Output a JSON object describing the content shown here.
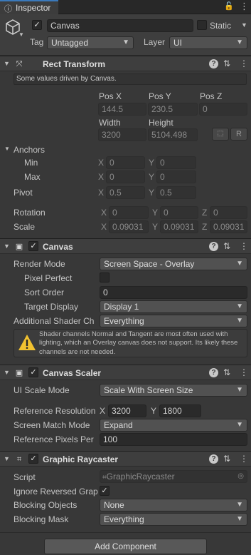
{
  "tab": {
    "title": "Inspector",
    "lock_icon": "lock-icon",
    "menu_icon": "kebab-menu-icon"
  },
  "object": {
    "name": "Canvas",
    "static_label": "Static",
    "tag_label": "Tag",
    "tag_value": "Untagged",
    "layer_label": "Layer",
    "layer_value": "UI"
  },
  "rect_transform": {
    "title": "Rect Transform",
    "info": "Some values driven by Canvas.",
    "pos_x_label": "Pos X",
    "pos_y_label": "Pos Y",
    "pos_z_label": "Pos Z",
    "pos_x": "144.5",
    "pos_y": "230.5",
    "pos_z": "0",
    "width_label": "Width",
    "height_label": "Height",
    "width": "3200",
    "height": "5104.498",
    "r_button": "R",
    "anchors_label": "Anchors",
    "min_label": "Min",
    "max_label": "Max",
    "min_x": "0",
    "min_y": "0",
    "max_x": "0",
    "max_y": "0",
    "pivot_label": "Pivot",
    "pivot_x": "0.5",
    "pivot_y": "0.5",
    "rotation_label": "Rotation",
    "rot_x": "0",
    "rot_y": "0",
    "rot_z": "0",
    "scale_label": "Scale",
    "scale_x": "0.09031",
    "scale_y": "0.09031",
    "scale_z": "0.09031"
  },
  "canvas": {
    "title": "Canvas",
    "render_mode_label": "Render Mode",
    "render_mode": "Screen Space - Overlay",
    "pixel_perfect_label": "Pixel Perfect",
    "sort_order_label": "Sort Order",
    "sort_order": "0",
    "target_display_label": "Target Display",
    "target_display": "Display 1",
    "shader_label": "Additional Shader Ch",
    "shader_value": "Everything",
    "warning": "Shader channels Normal and Tangent are most often used with lighting, which an Overlay canvas does not support. Its likely these channels are not needed."
  },
  "scaler": {
    "title": "Canvas Scaler",
    "ui_scale_label": "UI Scale Mode",
    "ui_scale": "Scale With Screen Size",
    "ref_res_label": "Reference Resolution",
    "ref_x": "3200",
    "ref_y": "1800",
    "match_label": "Screen Match Mode",
    "match": "Expand",
    "ppu_label": "Reference Pixels Per",
    "ppu": "100"
  },
  "raycaster": {
    "title": "Graphic Raycaster",
    "script_label": "Script",
    "script_value": "GraphicRaycaster",
    "ignore_label": "Ignore Reversed Grap",
    "blocking_objects_label": "Blocking Objects",
    "blocking_objects": "None",
    "blocking_mask_label": "Blocking Mask",
    "blocking_mask": "Everything"
  },
  "add_component": "Add Component",
  "axes": {
    "x": "X",
    "y": "Y",
    "z": "Z"
  }
}
